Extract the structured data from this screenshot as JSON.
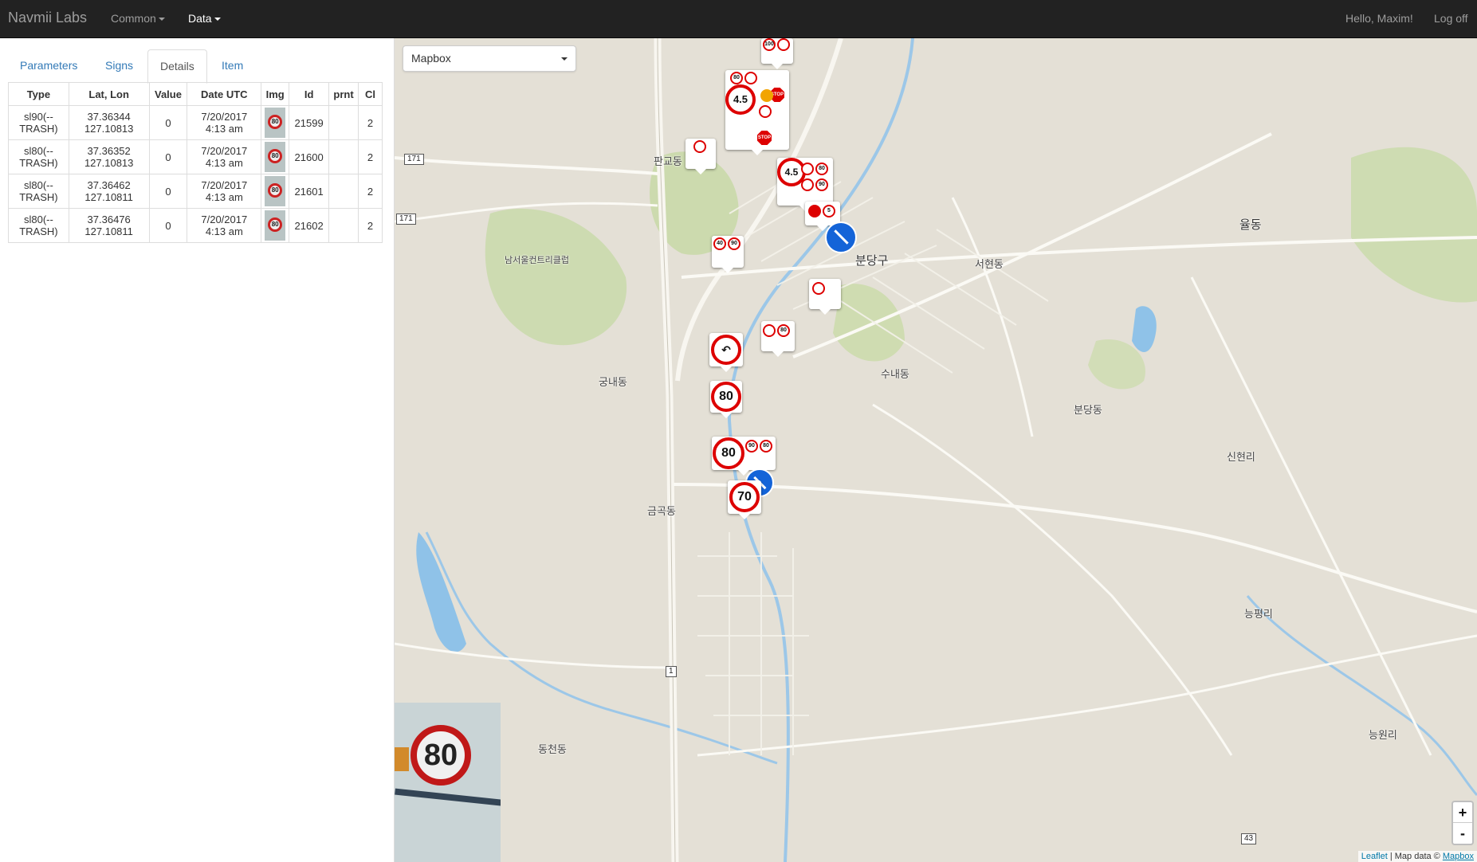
{
  "navbar": {
    "brand": "Navmii Labs",
    "menu_common": "Common",
    "menu_data": "Data",
    "greeting": "Hello, Maxim!",
    "logoff": "Log off"
  },
  "tabs": [
    {
      "label": "Parameters",
      "active": false
    },
    {
      "label": "Signs",
      "active": false
    },
    {
      "label": "Details",
      "active": true
    },
    {
      "label": "Item",
      "active": false
    }
  ],
  "table": {
    "headers": [
      "Type",
      "Lat, Lon",
      "Value",
      "Date UTC",
      "Img",
      "Id",
      "prnt",
      "Cl"
    ],
    "rows": [
      {
        "type": "sl90(--TRASH)",
        "latlon": "37.36344 127.10813",
        "value": "0",
        "date": "7/20/2017 4:13 am",
        "img": "80",
        "id": "21599",
        "prnt": "",
        "cl": "2"
      },
      {
        "type": "sl80(--TRASH)",
        "latlon": "37.36352 127.10813",
        "value": "0",
        "date": "7/20/2017 4:13 am",
        "img": "80",
        "id": "21600",
        "prnt": "",
        "cl": "2"
      },
      {
        "type": "sl80(--TRASH)",
        "latlon": "37.36462 127.10811",
        "value": "0",
        "date": "7/20/2017 4:13 am",
        "img": "80",
        "id": "21601",
        "prnt": "",
        "cl": "2"
      },
      {
        "type": "sl80(--TRASH)",
        "latlon": "37.36476 127.10811",
        "value": "0",
        "date": "7/20/2017 4:13 am",
        "img": "80",
        "id": "21602",
        "prnt": "",
        "cl": "2"
      }
    ]
  },
  "map": {
    "layer": "Mapbox",
    "places": {
      "pangyo": "판교동",
      "bundang": "분당구",
      "seohyeon": "서현동",
      "yuldong": "율동",
      "gungnae": "궁내동",
      "sunae": "수내동",
      "bundangdong": "분당동",
      "geumgok": "금곡동",
      "sinhyeon": "신현리",
      "neungpyeong": "능평리",
      "dongcheon": "동천동",
      "neungwon": "능원리",
      "golf": "남서울컨트리클럽"
    },
    "route_shields": [
      "171",
      "171",
      "1",
      "43"
    ],
    "markers": {
      "speed_a": "4.5",
      "speed_b": "4.5",
      "speed_80a": "80",
      "speed_80b": "80",
      "speed_70": "70",
      "mini": [
        "100",
        "80",
        "40",
        "90",
        "80",
        "90",
        "80",
        "90",
        "80",
        "5"
      ],
      "stop": "STOP"
    },
    "preview_value": "80",
    "zoom_in": "+",
    "zoom_out": "-",
    "attribution_leaflet": "Leaflet",
    "attribution_text": "| Map data ©",
    "attribution_mapbox": "Mapbox"
  }
}
